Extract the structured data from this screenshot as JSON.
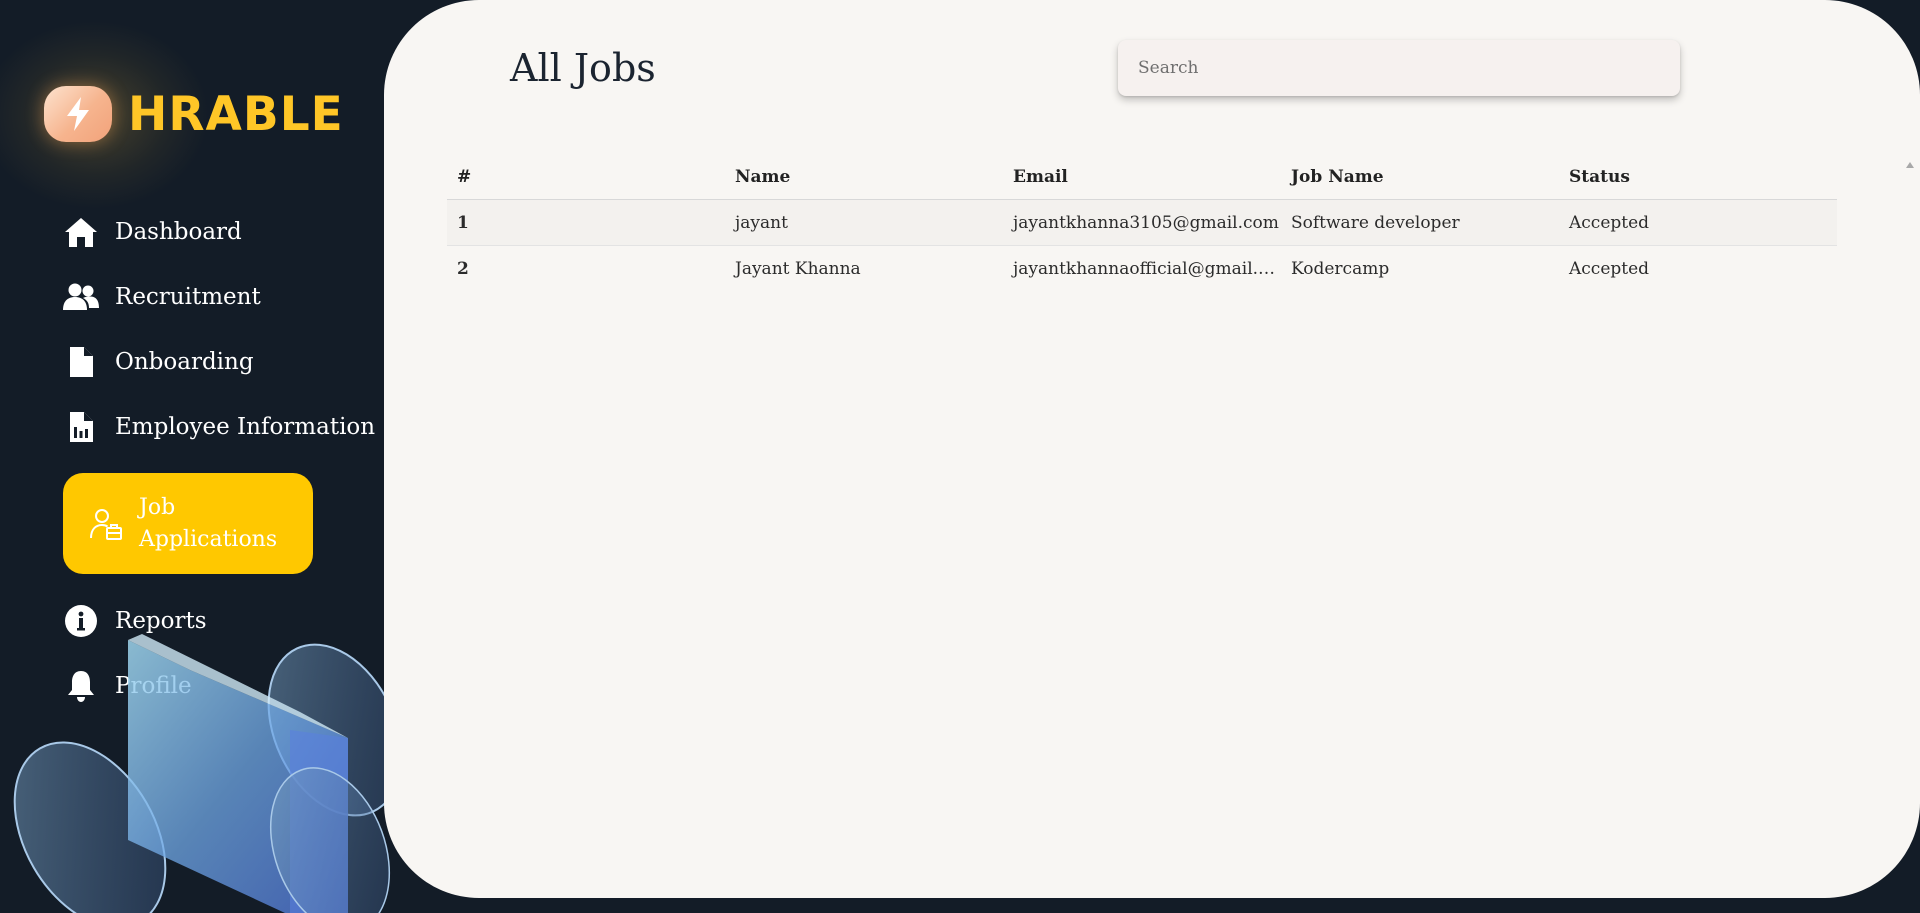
{
  "app": {
    "brand": "HRABLE",
    "accent": "#ffc800",
    "background": "#131c27"
  },
  "sidebar": {
    "items": [
      {
        "label": "Dashboard",
        "icon": "home-icon"
      },
      {
        "label": "Recruitment",
        "icon": "users-icon"
      },
      {
        "label": "Onboarding",
        "icon": "file-icon"
      },
      {
        "label": "Employee Information",
        "icon": "report-file-icon"
      },
      {
        "label": "Job Applications",
        "icon": "applicant-icon",
        "active": true
      },
      {
        "label": "Reports",
        "icon": "info-icon"
      },
      {
        "label": "Profile",
        "icon": "bell-icon"
      }
    ]
  },
  "main": {
    "title": "All Jobs",
    "search": {
      "placeholder": "Search",
      "value": ""
    },
    "table": {
      "columns": [
        "#",
        "Name",
        "Email",
        "Job Name",
        "Status"
      ],
      "rows": [
        {
          "num": "1",
          "name": "jayant",
          "email": "jayantkhanna3105@gmail.com",
          "job": "Software developer",
          "status": "Accepted"
        },
        {
          "num": "2",
          "name": "Jayant Khanna",
          "email": "jayantkhannaofficial@gmail.com",
          "job": "Kodercamp",
          "status": "Accepted"
        }
      ]
    }
  }
}
